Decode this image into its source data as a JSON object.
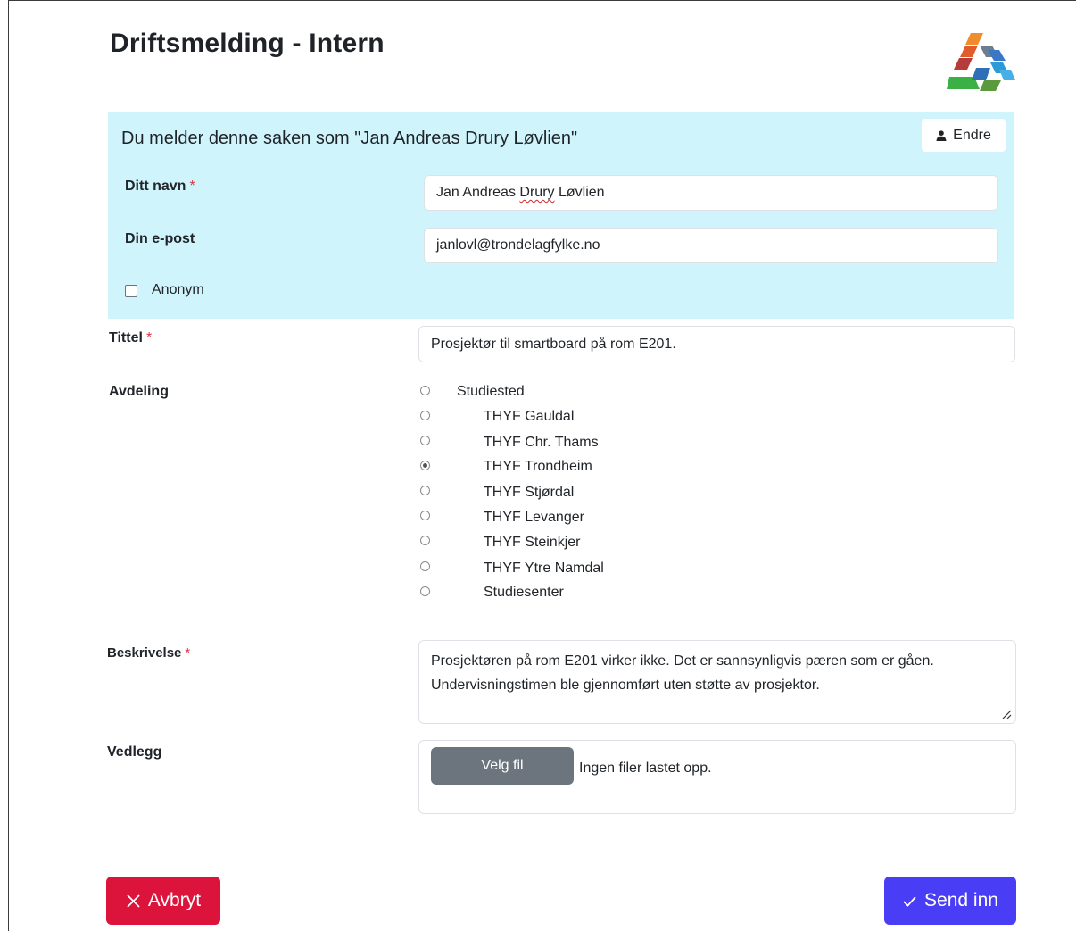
{
  "page": {
    "title": "Driftsmelding - Intern"
  },
  "user_panel": {
    "heading": "Du melder denne saken som \"Jan Andreas Drury Løvlien\"",
    "change_button": "Endre",
    "name_label": "Ditt navn",
    "name_value_first": "Jan Andreas ",
    "name_value_flagged": "Drury",
    "name_value_last": " Løvlien",
    "email_label": "Din e-post",
    "email_value": "janlovl@trondelagfylke.no",
    "anonymous_label": "Anonym",
    "anonymous_checked": false
  },
  "form": {
    "required_marker": "*",
    "title_label": "Tittel",
    "title_value": "Prosjektør til smartboard på rom E201.",
    "department_label": "Avdeling",
    "departments": [
      {
        "label": "Studiested",
        "selected": false
      },
      {
        "label": "THYF Gauldal",
        "selected": false
      },
      {
        "label": "THYF Chr. Thams",
        "selected": false
      },
      {
        "label": "THYF Trondheim",
        "selected": true
      },
      {
        "label": "THYF Stjørdal",
        "selected": false
      },
      {
        "label": "THYF Levanger",
        "selected": false
      },
      {
        "label": "THYF Steinkjer",
        "selected": false
      },
      {
        "label": "THYF Ytre Namdal",
        "selected": false
      },
      {
        "label": "Studiesenter",
        "selected": false
      }
    ],
    "description_label": "Beskrivelse",
    "description_line1": "Prosjektøren på rom E201 virker ikke. Det er sannsynligvis pæren som er gåen.",
    "description_line2": "Undervisningstimen ble gjennomført uten støtte av prosjektor.",
    "attachment_label": "Vedlegg",
    "file_button": "Velg fil",
    "file_status": "Ingen filer lastet opp."
  },
  "actions": {
    "cancel_label": "Avbryt",
    "submit_label": "Send inn"
  },
  "colors": {
    "panel_bg": "#cff4fc",
    "required": "#dc3545",
    "cancel": "#dc143c",
    "submit": "#4a3df6",
    "file_button": "#6c757d"
  }
}
